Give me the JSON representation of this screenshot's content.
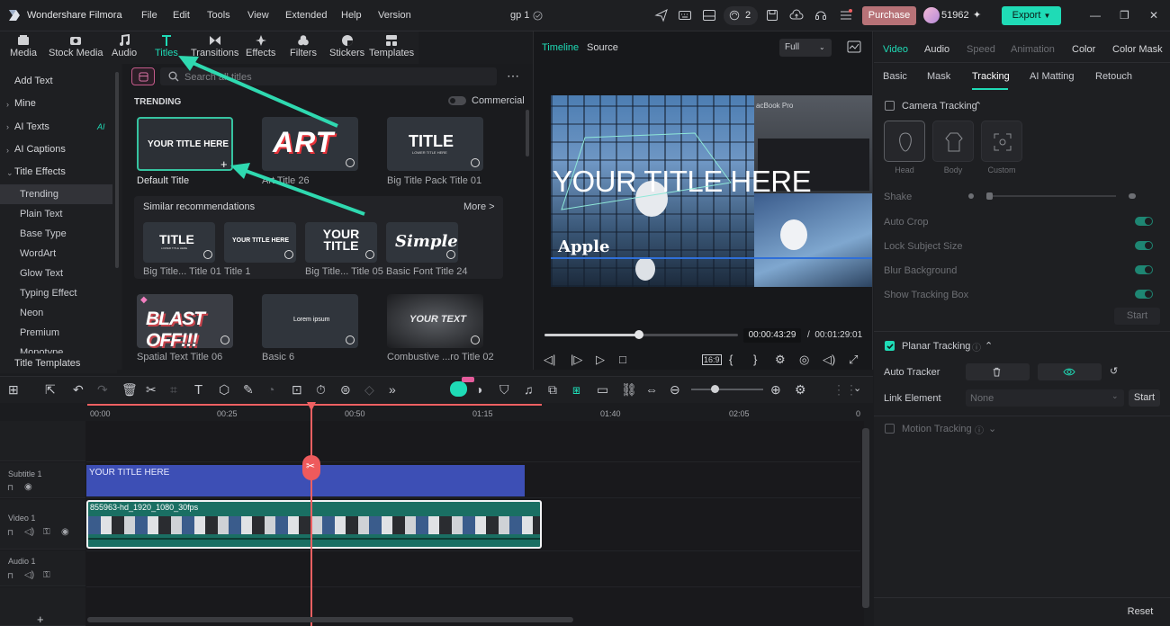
{
  "app": {
    "name": "Wondershare Filmora",
    "project": "gp 1",
    "credits": "51962",
    "purchase": "Purchase",
    "export": "Export",
    "notif_count": "2"
  },
  "menu": [
    "File",
    "Edit",
    "Tools",
    "View",
    "Extended",
    "Help",
    "Version"
  ],
  "media_tabs": [
    {
      "label": "Media",
      "icon": "media-icon"
    },
    {
      "label": "Stock Media",
      "icon": "stock-media-icon"
    },
    {
      "label": "Audio",
      "icon": "audio-icon"
    },
    {
      "label": "Titles",
      "icon": "titles-icon"
    },
    {
      "label": "Transitions",
      "icon": "transitions-icon"
    },
    {
      "label": "Effects",
      "icon": "effects-icon"
    },
    {
      "label": "Filters",
      "icon": "filters-icon"
    },
    {
      "label": "Stickers",
      "icon": "stickers-icon"
    },
    {
      "label": "Templates",
      "icon": "templates-icon"
    }
  ],
  "left_nav": {
    "add_text": "Add Text",
    "mine": "Mine",
    "ai_texts": "AI Texts",
    "ai_badge": "AI",
    "ai_captions": "AI Captions",
    "title_effects": "Title Effects",
    "sub": [
      "Trending",
      "Plain Text",
      "Base Type",
      "WordArt",
      "Glow Text",
      "Typing Effect",
      "Neon",
      "Premium",
      "Monotype"
    ],
    "title_templates": "Title Templates"
  },
  "search": {
    "placeholder": "Search all titles"
  },
  "trending": {
    "label": "TRENDING",
    "commercial": "Commercial"
  },
  "titles": [
    {
      "caption": "Default Title",
      "thumb": "YOUR TITLE HERE"
    },
    {
      "caption": "Art Title 26",
      "thumb": "ART"
    },
    {
      "caption": "Big Title Pack Title 01",
      "thumb": "TITLE",
      "thumb_sub": "LOWER TITLE HERE"
    }
  ],
  "similar": {
    "label": "Similar recommendations",
    "more": "More >",
    "items": [
      {
        "caption": "Big Title... Title 01",
        "thumb": "TITLE",
        "thumb_sub": "LOWER TITLE HERE"
      },
      {
        "caption": "Title 1",
        "thumb": "YOUR TITLE HERE"
      },
      {
        "caption": "Big Title... Title 05",
        "thumb": "YOUR TITLE"
      },
      {
        "caption": "Basic Font Title 24",
        "thumb": "Simple"
      }
    ]
  },
  "row3": [
    {
      "caption": "Spatial Text Title 06",
      "thumb": "BLAST OFF!!!"
    },
    {
      "caption": "Basic 6",
      "thumb": "Lorem ipsum"
    },
    {
      "caption": "Combustive ...ro Title 02",
      "thumb": "YOUR TEXT"
    }
  ],
  "player": {
    "tab_timeline": "Timeline",
    "tab_source": "Source",
    "quality": "Full",
    "overlay_title": "YOUR TITLE HERE",
    "overlay_sub": "Apple",
    "screen_text": "acBook Pro",
    "time_current": "00:00:43:29",
    "time_sep": "/",
    "time_total": "00:01:29:01",
    "progress": 0.49
  },
  "right": {
    "tabs": [
      "Video",
      "Audio",
      "Speed",
      "Animation",
      "Color",
      "Color Mask"
    ],
    "subtabs": [
      "Basic",
      "Mask",
      "Tracking",
      "AI Matting",
      "Retouch"
    ],
    "camera_tracking": "Camera Tracking",
    "track_targets": [
      "Head",
      "Body",
      "Custom"
    ],
    "shake": "Shake",
    "auto_crop": "Auto Crop",
    "lock_subject": "Lock Subject Size",
    "blur_bg": "Blur Background",
    "show_box": "Show Tracking Box",
    "start": "Start",
    "planar_tracking": "Planar Tracking",
    "auto_tracker": "Auto Tracker",
    "link_element": "Link Element",
    "link_value": "None",
    "start2": "Start",
    "motion_tracking": "Motion Tracking",
    "reset": "Reset"
  },
  "ruler": [
    "00:00",
    "00:25",
    "00:50",
    "01:15",
    "01:40",
    "02:05"
  ],
  "tracks": {
    "subtitle": "Subtitle 1",
    "video": "Video 1",
    "audio": "Audio 1",
    "subclip": "YOUR TITLE HERE",
    "videoclip": "855963-hd_1920_1080_30fps"
  },
  "colors": {
    "accent": "#1fdbb6",
    "playhead": "#ef6062",
    "subtitle_clip": "#3d4fb5",
    "video_clip": "#1a6f63",
    "purchase": "#b77277"
  }
}
